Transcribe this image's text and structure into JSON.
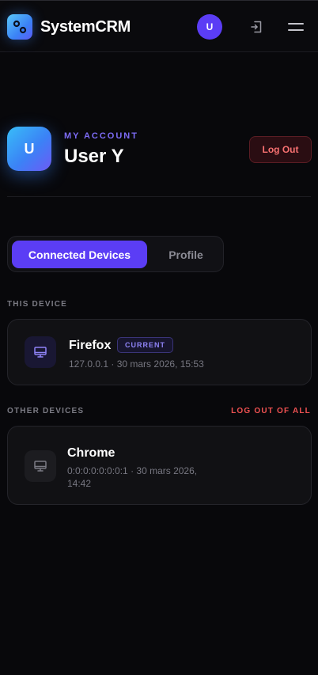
{
  "header": {
    "app_title": "SystemCRM",
    "avatar_initial": "U",
    "icons": {
      "logo": "app-logo-icon",
      "logout": "logout-icon",
      "menu": "hamburger-menu-icon"
    }
  },
  "account": {
    "avatar_initial": "U",
    "kicker": "MY ACCOUNT",
    "user_name": "User Y",
    "logout_label": "Log Out"
  },
  "tabs": [
    {
      "label": "Connected Devices",
      "active": true
    },
    {
      "label": "Profile",
      "active": false
    }
  ],
  "this_device": {
    "section_label": "THIS DEVICE",
    "device": {
      "name": "Firefox",
      "badge": "CURRENT",
      "meta": "127.0.0.1 · 30 mars 2026, 15:53",
      "icon": "monitor-icon"
    }
  },
  "other_devices": {
    "section_label": "OTHER DEVICES",
    "logout_all_label": "LOG OUT OF ALL",
    "devices": [
      {
        "name": "Chrome",
        "meta_line1": "0:0:0:0:0:0:0:1 · 30 mars 2026,",
        "meta_line2": "14:42",
        "icon": "monitor-icon"
      }
    ]
  },
  "colors": {
    "accent": "#5b3df5",
    "danger": "#f05252",
    "background": "#08080b"
  }
}
